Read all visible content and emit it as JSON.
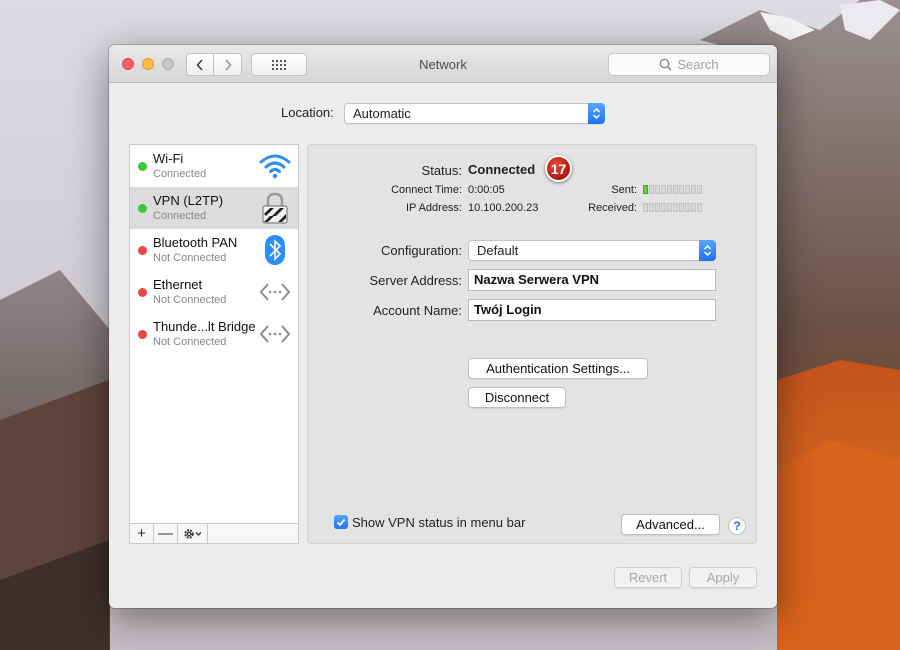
{
  "window": {
    "title": "Network",
    "search_placeholder": "Search"
  },
  "location": {
    "label": "Location:",
    "value": "Automatic"
  },
  "services": [
    {
      "name": "Wi-Fi",
      "status": "Connected",
      "state": "green",
      "icon": "wifi-icon"
    },
    {
      "name": "VPN (L2TP)",
      "status": "Connected",
      "state": "green",
      "icon": "vpn-lock-icon",
      "selected": true
    },
    {
      "name": "Bluetooth PAN",
      "status": "Not Connected",
      "state": "red",
      "icon": "bluetooth-icon"
    },
    {
      "name": "Ethernet",
      "status": "Not Connected",
      "state": "red",
      "icon": "ethernet-icon"
    },
    {
      "name": "Thunde...lt Bridge",
      "status": "Not Connected",
      "state": "red",
      "icon": "thunderbolt-bridge-icon"
    }
  ],
  "sidebar_toolbar": {
    "add": "+",
    "remove": "—"
  },
  "detail": {
    "status_label": "Status:",
    "status_value": "Connected",
    "badge": "17",
    "connect_time_label": "Connect Time:",
    "connect_time_value": "0:00:05",
    "ip_label": "IP Address:",
    "ip_value": "10.100.200.23",
    "sent_label": "Sent:",
    "received_label": "Received:",
    "sent_level": 1,
    "received_level": 0,
    "meter_segments": 10,
    "configuration_label": "Configuration:",
    "configuration_value": "Default",
    "server_label": "Server Address:",
    "server_value": "Nazwa Serwera VPN",
    "account_label": "Account Name:",
    "account_value": "Twój Login",
    "auth_button": "Authentication Settings...",
    "disconnect_button": "Disconnect",
    "show_vpn_label": "Show VPN status in menu bar",
    "show_vpn_checked": true,
    "advanced_button": "Advanced...",
    "help": "?"
  },
  "footer": {
    "revert": "Revert",
    "apply": "Apply"
  },
  "colors": {
    "accent": "#1d71f2",
    "connected": "#3cc63a",
    "not_connected": "#ea4744",
    "badge": "#c0392b"
  }
}
